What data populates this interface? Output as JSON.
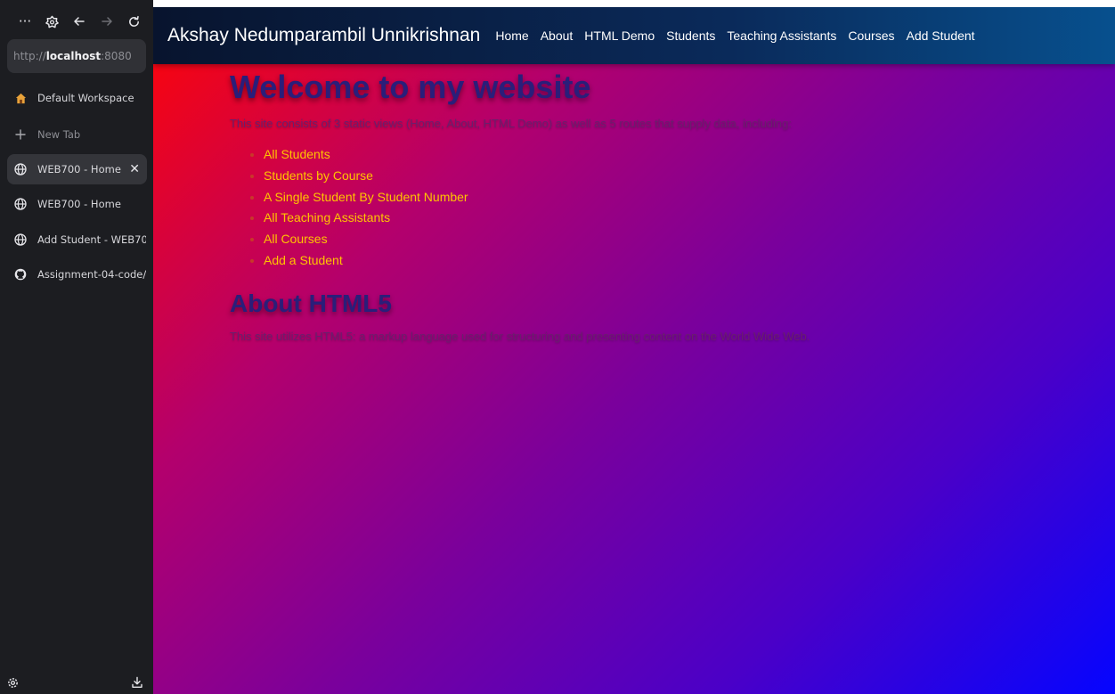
{
  "browser": {
    "url_prefix": "http://",
    "url_host": "localhost",
    "url_port": ":8080",
    "workspace": "Default Workspace",
    "new_tab": "New Tab",
    "tabs": [
      {
        "label": "WEB700 - Home",
        "icon": "globe-icon",
        "active": true
      },
      {
        "label": "WEB700 - Home",
        "icon": "globe-icon",
        "active": false
      },
      {
        "label": "Add Student - WEB700",
        "icon": "globe-icon",
        "active": false
      },
      {
        "label": "Assignment-04-code/",
        "icon": "github-icon",
        "active": false
      }
    ]
  },
  "site": {
    "brand": "Akshay Nedumparambil Unnikrishnan",
    "nav": [
      "Home",
      "About",
      "HTML Demo",
      "Students",
      "Teaching Assistants",
      "Courses",
      "Add Student"
    ]
  },
  "main": {
    "heading": "Welcome to my website",
    "intro": "This site consists of 3 static views (Home, About, HTML Demo) as well as 5 routes that supply data, including:",
    "links": [
      "All Students",
      "Students by Course",
      "A Single Student By Student Number",
      "All Teaching Assistants",
      "All Courses",
      "Add a Student"
    ],
    "about_heading": "About HTML5",
    "about_text": "This site utilizes HTML5: a markup language used for structuring and presenting content on the World Wide Web."
  },
  "colors": {
    "sidebar_bg": "#1c1d21",
    "navbar": "#0a2a5a",
    "heading": "#2a1e7a",
    "link": "#ffc400",
    "gradient_start": "#ff0505",
    "gradient_end": "#0505ff"
  }
}
